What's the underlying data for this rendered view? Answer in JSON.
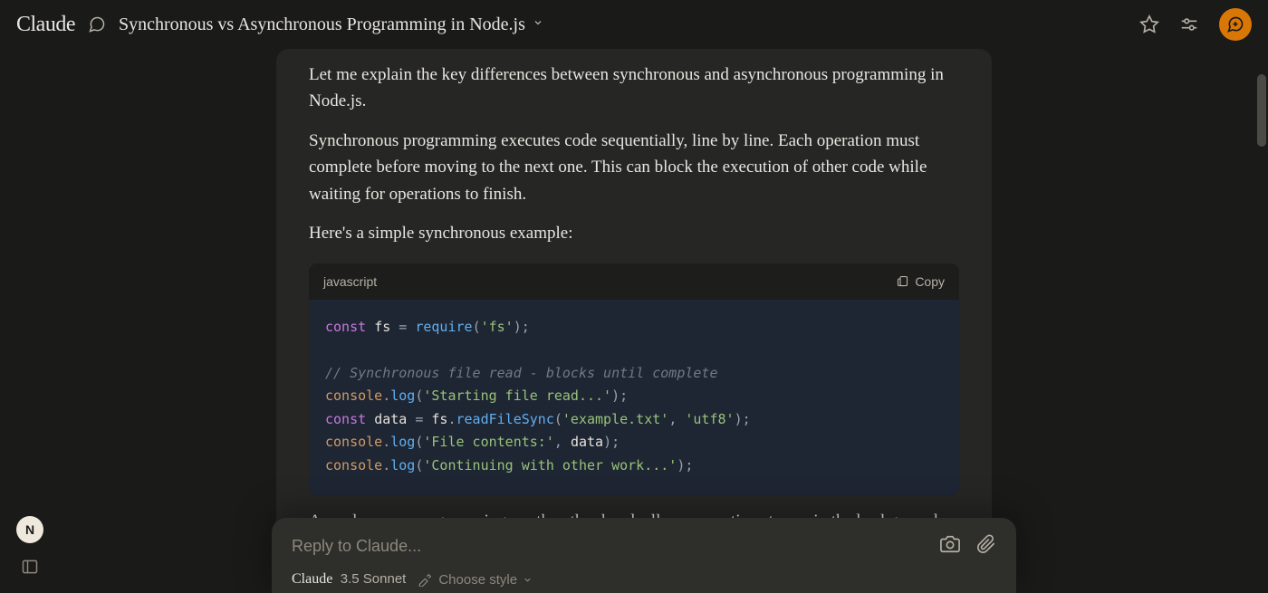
{
  "header": {
    "logo": "Claude",
    "title": "Synchronous vs Asynchronous Programming in Node.js"
  },
  "message": {
    "p1": "Let me explain the key differences between synchronous and asynchronous programming in Node.js.",
    "p2": "Synchronous programming executes code sequentially, line by line. Each operation must complete before moving to the next one. This can block the execution of other code while waiting for operations to finish.",
    "p3": "Here's a simple synchronous example:",
    "p4": "Asynchronous programming, on the other hand, allows operations to run in the background while other code continues to execute. This is especially important for I/O"
  },
  "code": {
    "lang": "javascript",
    "copy": "Copy",
    "tokens": {
      "const": "const",
      "fs": "fs",
      "eq": "=",
      "require": "require",
      "open": "(",
      "close": ")",
      "semi": ";",
      "str_fs": "'fs'",
      "cmt1": "// Synchronous file read - blocks until complete",
      "console": "console",
      "dot": ".",
      "log": "log",
      "str_start": "'Starting file read...'",
      "data": "data",
      "fsvar": "fs",
      "readsync": "readFileSync",
      "str_file": "'example.txt'",
      "comma": ",",
      "str_utf8": "'utf8'",
      "str_contents": "'File contents:'",
      "datavar": "data",
      "str_cont": "'Continuing with other work...'"
    }
  },
  "input": {
    "placeholder": "Reply to Claude...",
    "model_name": "Claude",
    "model_version": "3.5 Sonnet",
    "style_label": "Choose style"
  },
  "user": {
    "initial": "N"
  }
}
